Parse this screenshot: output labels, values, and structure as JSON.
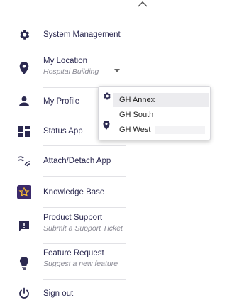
{
  "menu": {
    "system_management": {
      "label": "System Management",
      "icon": "gear-icon"
    },
    "location": {
      "label": "My Location",
      "value": "Hospital Building",
      "icon": "map-pin-icon"
    },
    "profile": {
      "label": "My Profile",
      "icon": "user-icon"
    },
    "status_app": {
      "label": "Status App",
      "icon": "dashboard-icon"
    },
    "attach_detach": {
      "label": "Attach/Detach App",
      "icon": "signal-icon"
    },
    "knowledge_base": {
      "label": "Knowledge Base",
      "icon": "knowledge-base-logo-icon"
    },
    "product_support": {
      "label": "Product Support",
      "sub": "Submit a Support Ticket",
      "icon": "chat-alert-icon"
    },
    "feature_request": {
      "label": "Feature Request",
      "sub": "Suggest a new feature",
      "icon": "lightbulb-icon"
    },
    "sign_out": {
      "label": "Sign out",
      "icon": "power-icon"
    }
  },
  "location_dropdown": {
    "options": [
      "GH Annex",
      "GH South",
      "GH West"
    ],
    "highlighted": "GH Annex"
  },
  "colors": {
    "icon": "#2b2950",
    "text": "#2b2950",
    "subtext": "#8a8a95",
    "knowledge_base_icon_bg": "#3b2a6b",
    "knowledge_base_icon_fg": "#f2b634"
  }
}
